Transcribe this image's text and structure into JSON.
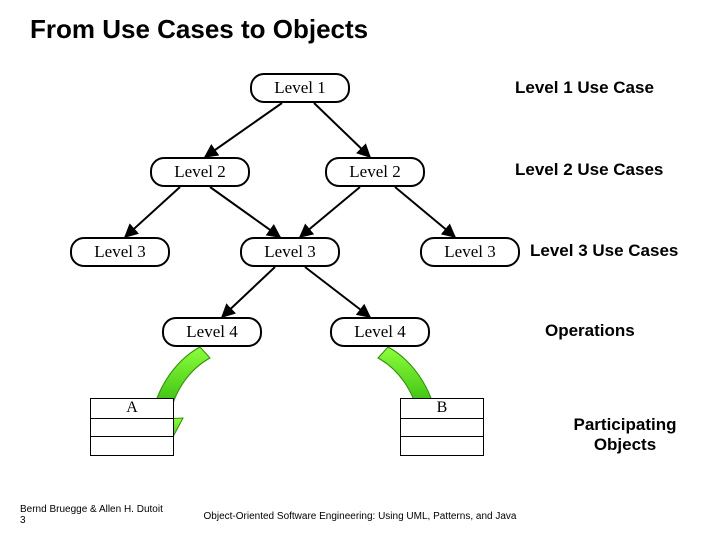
{
  "title": "From Use Cases to Objects",
  "nodes": {
    "l1": "Level 1",
    "l2a": "Level 2",
    "l2b": "Level 2",
    "l3a": "Level 3",
    "l3b": "Level 3",
    "l3c": "Level 3",
    "l4a": "Level 4",
    "l4b": "Level 4"
  },
  "side": {
    "r1": "Level 1 Use Case",
    "r2": "Level 2 Use Cases",
    "r3": "Level 3 Use Cases",
    "r4": "Operations",
    "r5a": "Participating",
    "r5b": "Objects"
  },
  "objects": {
    "a": "A",
    "b": "B"
  },
  "footer": {
    "left1": "Bernd Bruegge & Allen H. Dutoit",
    "left2": "3",
    "mid": "Object-Oriented Software Engineering: Using UML, Patterns, and Java"
  }
}
